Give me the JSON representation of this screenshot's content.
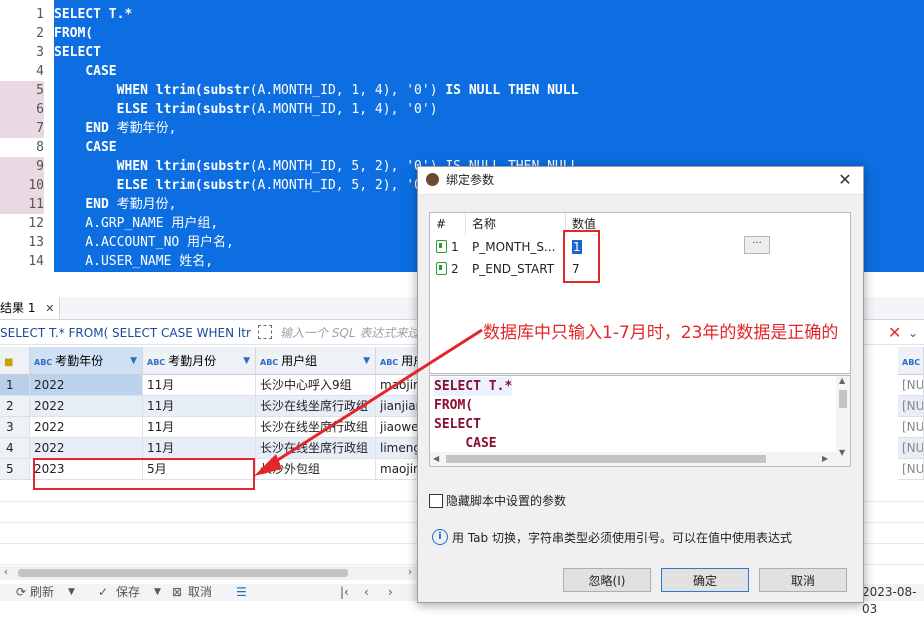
{
  "editor": {
    "line_numbers": [
      "1",
      "2",
      "3",
      "4",
      "5",
      "6",
      "7",
      "8",
      "9",
      "10",
      "11",
      "12",
      "13",
      "14"
    ],
    "lines": [
      [
        {
          "t": "SELECT T.*",
          "k": 1
        }
      ],
      [
        {
          "t": "FROM(",
          "k": 1
        }
      ],
      [
        {
          "t": "SELECT",
          "k": 1
        }
      ],
      [
        {
          "t": "    "
        },
        {
          "t": "CASE",
          "k": 1
        }
      ],
      [
        {
          "t": "        "
        },
        {
          "t": "WHEN ltrim(substr",
          "k": 1
        },
        {
          "t": "(A.MONTH_ID, 1, 4), '0') "
        },
        {
          "t": "IS NULL THEN NULL",
          "k": 1
        }
      ],
      [
        {
          "t": "        "
        },
        {
          "t": "ELSE ltrim(substr",
          "k": 1
        },
        {
          "t": "(A.MONTH_ID, 1, 4), '0')"
        }
      ],
      [
        {
          "t": "    "
        },
        {
          "t": "END",
          "k": 1
        },
        {
          "t": " 考勤年份,"
        }
      ],
      [
        {
          "t": "    "
        },
        {
          "t": "CASE",
          "k": 1
        }
      ],
      [
        {
          "t": "        "
        },
        {
          "t": "WHEN ltrim(substr",
          "k": 1
        },
        {
          "t": "(A.MONTH_ID, 5, 2), '0') IS NULL THEN NULL"
        }
      ],
      [
        {
          "t": "        "
        },
        {
          "t": "ELSE ltrim(substr",
          "k": 1
        },
        {
          "t": "(A.MONTH_ID, 5, 2), '0')"
        }
      ],
      [
        {
          "t": "    "
        },
        {
          "t": "END",
          "k": 1
        },
        {
          "t": " 考勤月份,"
        }
      ],
      [
        {
          "t": "    A.GRP_NAME 用户组,"
        }
      ],
      [
        {
          "t": "    A.ACCOUNT_NO 用户名,"
        }
      ],
      [
        {
          "t": "    A.USER_NAME 姓名,"
        }
      ]
    ]
  },
  "results": {
    "tab_label": "结果 1",
    "tab_close": "✕",
    "filter_sql": "SELECT T.* FROM( SELECT CASE WHEN ltrim",
    "filter_placeholder": "输入一个 SQL 表达式来过",
    "columns": [
      "考勤年份",
      "考勤月份",
      "用户组",
      "用户"
    ],
    "type_label": "ABC",
    "rows": [
      {
        "n": "1",
        "c": [
          "2022",
          "11月",
          "长沙中心呼入9组",
          "maojin"
        ]
      },
      {
        "n": "2",
        "c": [
          "2022",
          "11月",
          "长沙在线坐席行政组",
          "jianjian"
        ]
      },
      {
        "n": "3",
        "c": [
          "2022",
          "11月",
          "长沙在线坐席行政组",
          "jiaowei"
        ]
      },
      {
        "n": "4",
        "c": [
          "2022",
          "11月",
          "长沙在线坐席行政组",
          "limeng"
        ]
      },
      {
        "n": "5",
        "c": [
          "2023",
          "5月",
          "长沙外包组",
          "maojin"
        ]
      }
    ],
    "right_col_values": [
      "[NU",
      "[NU",
      "[NU",
      "[NU",
      "[NU"
    ],
    "bottom": {
      "refresh": "刷新",
      "save": "保存",
      "cancel": "取消",
      "timestamp": "2023-08-03"
    }
  },
  "dialog": {
    "title": "绑定参数",
    "close": "✕",
    "headers": [
      "#",
      "名称",
      "数值"
    ],
    "params": [
      {
        "idx": "1",
        "name": "P_MONTH_S...",
        "value": "1"
      },
      {
        "idx": "2",
        "name": "P_END_START",
        "value": "7"
      }
    ],
    "ellipsis": "···",
    "sql_preview": [
      [
        {
          "t": "SELECT T.*",
          "k": "kw"
        }
      ],
      [
        {
          "t": "FROM(",
          "k": "kw"
        }
      ],
      [
        {
          "t": "SELECT",
          "k": "kw"
        }
      ],
      [
        {
          "t": "    "
        },
        {
          "t": "CASE",
          "k": "kw"
        }
      ],
      [
        {
          "t": "        "
        },
        {
          "t": "WHEN",
          "k": "kw"
        },
        {
          "t": " "
        },
        {
          "t": "ltrim",
          "k": "fn"
        },
        {
          "t": "("
        },
        {
          "t": "substr",
          "k": "fn"
        },
        {
          "t": "(A.MONTH_ID, 1, 4)"
        }
      ]
    ],
    "hide_params_label": "隐藏脚本中设置的参数",
    "info": "用 Tab 切换，字符串类型必须使用引号。可以在值中使用表达式",
    "buttons": {
      "ignore": "忽略(I)",
      "ok": "确定",
      "cancel": "取消"
    }
  },
  "annotation": {
    "text": "数据库中只输入1-7月时，23年的数据是正确的",
    "color": "#e3262a"
  }
}
